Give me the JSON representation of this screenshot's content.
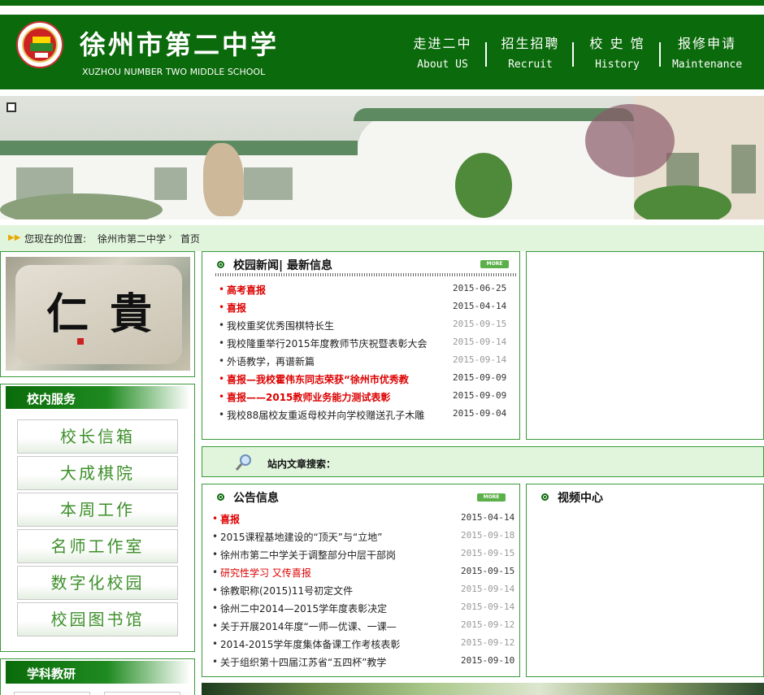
{
  "header": {
    "school_name_cn": "徐州市第二中学",
    "school_name_en": "XUZHOU NUMBER TWO MIDDLE SCHOOL",
    "nav": [
      {
        "cn": "走进二中",
        "en": "About US"
      },
      {
        "cn": "招生招聘",
        "en": "Recruit"
      },
      {
        "cn": "校 史 馆",
        "en": "History"
      },
      {
        "cn": "报修申请",
        "en": "Maintenance"
      }
    ],
    "brand_color": "#0b6a0b"
  },
  "breadcrumb": {
    "label": "您现在的位置:",
    "home": "徐州市第二中学",
    "separator": "›",
    "current": "首页"
  },
  "left": {
    "photo_chars": [
      "仁",
      "貴"
    ],
    "services_title": "校内服务",
    "services": [
      "校长信箱",
      "大成棋院",
      "本周工作",
      "名师工作室",
      "数字化校园",
      "校园图书馆"
    ],
    "subjects_title": "学科教研"
  },
  "news": {
    "title": "校园新闻| 最新信息",
    "more": "MORE",
    "items": [
      {
        "text": "高考喜报",
        "date": "2015-06-25",
        "style": "red"
      },
      {
        "text": "喜报",
        "date": "2015-04-14",
        "style": "red"
      },
      {
        "text": "我校重奖优秀围棋特长生",
        "date": "2015-09-15",
        "style": "grey"
      },
      {
        "text": "我校隆重举行2015年度教师节庆祝暨表彰大会",
        "date": "2015-09-14",
        "style": "grey"
      },
      {
        "text": "外语教学，再谱新篇",
        "date": "2015-09-14",
        "style": "grey"
      },
      {
        "text": "喜报—我校霍伟东同志荣获“徐州市优秀教",
        "date": "2015-09-09",
        "style": "red"
      },
      {
        "text": "喜报——2015教师业务能力测试表彰",
        "date": "2015-09-09",
        "style": "red"
      },
      {
        "text": "我校88届校友重返母校并向学校赠送孔子木雕",
        "date": "2015-09-04",
        "style": "normal"
      }
    ]
  },
  "search": {
    "label": "站内文章搜索："
  },
  "notices": {
    "title": "公告信息",
    "more": "MORE",
    "items": [
      {
        "text": "喜报",
        "date": "2015-04-14",
        "style": "red"
      },
      {
        "text": "2015课程基地建设的“顶天”与“立地”",
        "date": "2015-09-18",
        "style": "grey"
      },
      {
        "text": "徐州市第二中学关于调整部分中层干部岗",
        "date": "2015-09-15",
        "style": "grey"
      },
      {
        "text": "研究性学习 又传喜报",
        "date": "2015-09-15",
        "style": "redplain"
      },
      {
        "text": "徐教职称(2015)11号初定文件",
        "date": "2015-09-14",
        "style": "grey"
      },
      {
        "text": "徐州二中2014—2015学年度表彰决定",
        "date": "2015-09-14",
        "style": "grey"
      },
      {
        "text": "关于开展2014年度“一师—优课、一课—",
        "date": "2015-09-12",
        "style": "grey"
      },
      {
        "text": "2014-2015学年度集体备课工作考核表彰",
        "date": "2015-09-12",
        "style": "grey"
      },
      {
        "text": "关于组织第十四届江苏省“五四杯”教学",
        "date": "2015-09-10",
        "style": "normal"
      }
    ]
  },
  "video": {
    "title": "视频中心"
  }
}
